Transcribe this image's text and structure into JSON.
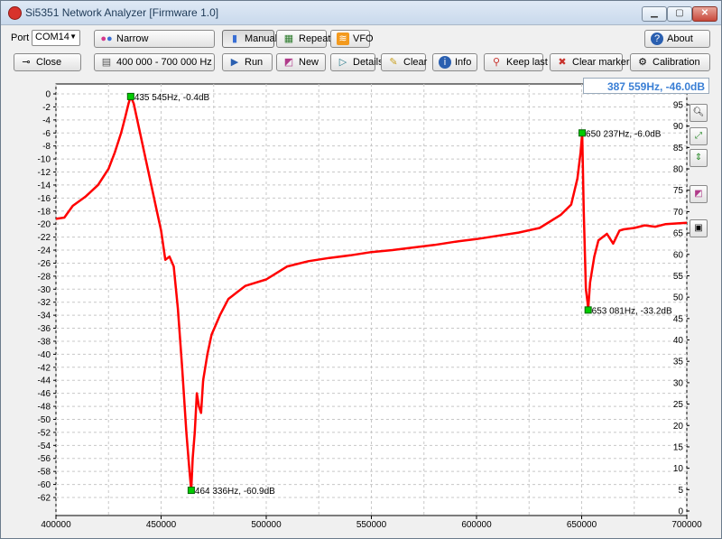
{
  "window": {
    "title": "Si5351 Network Analyzer [Firmware 1.0]"
  },
  "toolbar": {
    "port_label": "Port",
    "port_value": "COM14",
    "narrow_label": "Narrow",
    "manual_label": "Manual",
    "repeat_label": "Repeat",
    "vfo_label": "VFO",
    "about_label": "About",
    "close_label": "Close",
    "range_label": "400 000 - 700 000 Hz",
    "run_label": "Run",
    "new_label": "New",
    "details_label": "Details",
    "clear_label": "Clear",
    "info_label": "Info",
    "keep_last_label": "Keep last",
    "clear_markers_label": "Clear markers",
    "calibration_label": "Calibration"
  },
  "readout": {
    "cursor": "387 559Hz, -46.0dB"
  },
  "colors": {
    "trace": "#ff0000",
    "marker": "#00cc00",
    "readout_text": "#3a7fd5"
  },
  "chart_data": {
    "type": "line",
    "x_range": [
      400000,
      700000
    ],
    "x_ticks": [
      400000,
      450000,
      500000,
      550000,
      600000,
      650000,
      700000
    ],
    "y_left_range": [
      -62,
      0
    ],
    "y_right_range": [
      0,
      97
    ],
    "y_right_ticks": [
      0,
      5,
      10,
      15,
      20,
      25,
      30,
      35,
      40,
      45,
      50,
      55,
      60,
      65,
      70,
      75,
      80,
      85,
      90,
      95
    ],
    "grid": true,
    "series": [
      {
        "x": [
          400000,
          404000,
          408000,
          414000,
          420000,
          425000,
          428000,
          431000,
          433000,
          434500,
          435545,
          437000,
          440000,
          444000,
          448000,
          450000,
          452000,
          454000,
          456000,
          458000,
          460000,
          462000,
          463500,
          464336,
          465000,
          466000,
          467000,
          468000,
          469000,
          470000,
          472000,
          474000,
          478000,
          482000,
          486000,
          490000,
          495000,
          500000,
          505000,
          510000,
          520000,
          530000,
          540000,
          550000,
          560000,
          570000,
          580000,
          590000,
          600000,
          610000,
          620000,
          630000,
          640000,
          645000,
          648000,
          649500,
          650237,
          651000,
          652000,
          652800,
          653081,
          654000,
          656000,
          658000,
          662000,
          665000,
          668000,
          670000,
          675000,
          680000,
          685000,
          690000,
          695000,
          700000
        ],
        "y": [
          -19.2,
          -19,
          -17.2,
          -15.8,
          -14,
          -11.5,
          -9,
          -6,
          -3.5,
          -1.5,
          -0.4,
          -1.5,
          -6,
          -12,
          -18,
          -21,
          -25.5,
          -25,
          -26.5,
          -33,
          -42,
          -52,
          -58,
          -60.9,
          -56,
          -52,
          -46,
          -48,
          -49,
          -44,
          -40,
          -37,
          -34,
          -31.5,
          -30.5,
          -29.5,
          -29,
          -28.5,
          -27.5,
          -26.5,
          -25.7,
          -25.2,
          -24.8,
          -24.3,
          -24,
          -23.6,
          -23.2,
          -22.7,
          -22.3,
          -21.8,
          -21.3,
          -20.6,
          -18.6,
          -17,
          -13,
          -9,
          -6,
          -18,
          -30,
          -32,
          -33.2,
          -29,
          -25,
          -22.5,
          -21.5,
          -23,
          -21,
          -20.8,
          -20.6,
          -20.2,
          -20.4,
          -20,
          -19.9,
          -19.8
        ]
      }
    ],
    "markers": [
      {
        "x": 435545,
        "y": -0.4,
        "label": "435 545Hz, -0.4dB"
      },
      {
        "x": 464336,
        "y": -60.9,
        "label": "464 336Hz, -60.9dB"
      },
      {
        "x": 650237,
        "y": -6.0,
        "label": "650 237Hz, -6.0dB"
      },
      {
        "x": 653081,
        "y": -33.2,
        "label": "653 081Hz, -33.2dB"
      }
    ]
  }
}
